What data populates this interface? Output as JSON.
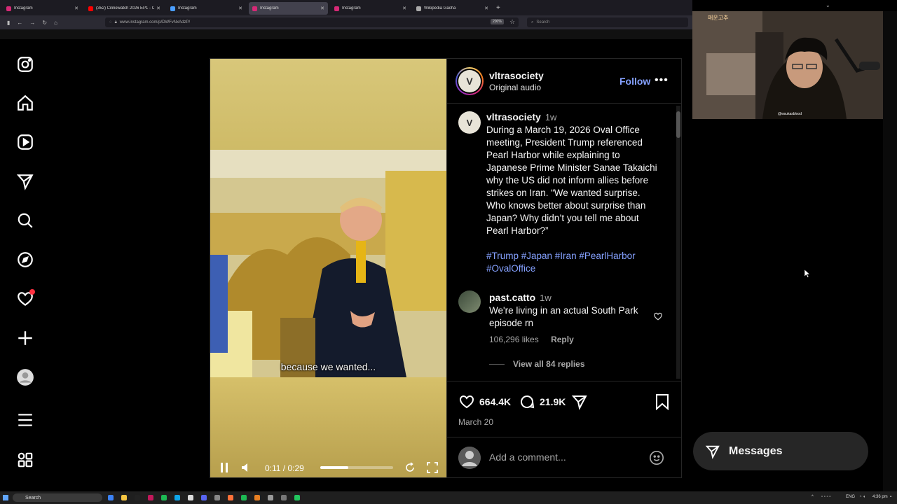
{
  "browser": {
    "tabs": [
      {
        "label": "Instagram",
        "color": "#d62976",
        "active": false
      },
      {
        "label": "(352) Cilinewatch 2026 EP1 - C...",
        "color": "#ff0000",
        "active": false
      },
      {
        "label": "Instagram",
        "color": "#4a9eff",
        "active": false
      },
      {
        "label": "Instagram",
        "color": "#d62976",
        "active": true
      },
      {
        "label": "Instagram",
        "color": "#d62976",
        "active": false
      },
      {
        "label": "Wikipedia Gacha",
        "color": "#aaaaaa",
        "active": false
      }
    ],
    "url": "www.instagram.com/p/DWFvNxAdzP/",
    "zoom": "200%",
    "search_placeholder": "Search"
  },
  "leftnav": {
    "items": [
      "instagram-logo",
      "home",
      "reels",
      "messages",
      "search",
      "explore",
      "notifications",
      "create",
      "profile",
      "menu",
      "also-from-meta"
    ]
  },
  "post": {
    "video": {
      "caption": "because we wanted...",
      "time": "0:11 / 0:29",
      "progress_fraction": 0.38
    },
    "header": {
      "username": "vltrasociety",
      "audio": "Original audio",
      "follow_label": "Follow",
      "more_label": "•••",
      "avatar_letter": "V"
    },
    "caption": {
      "username": "vltrasociety",
      "time": "1w",
      "text": "During a March 19, 2026 Oval Office meeting, President Trump referenced Pearl Harbor while explaining to Japanese Prime Minister Sanae Takaichi why the US did not inform allies before strikes on Iran. “We wanted surprise. Who knows better about surprise than Japan? Why didn’t you tell me about Pearl Harbor?”",
      "hashtags": "#Trump #Japan #Iran #PearlHarbor #OvalOffice"
    },
    "comment": {
      "username": "past.catto",
      "time": "1w",
      "text": "We're living in an actual South Park episode rn",
      "likes": "106,296 likes",
      "reply_label": "Reply",
      "view_replies": "View all 84 replies"
    },
    "actions": {
      "likes": "664.4K",
      "comments": "21.9K",
      "date": "March 20"
    },
    "add_comment_placeholder": "Add a comment..."
  },
  "webcam": {
    "tag": "@wsukasblood",
    "logo": "매운고추"
  },
  "messages": {
    "label": "Messages"
  },
  "taskbar": {
    "search_label": "Search",
    "lang": "ENG",
    "time": "4:36 pm"
  }
}
